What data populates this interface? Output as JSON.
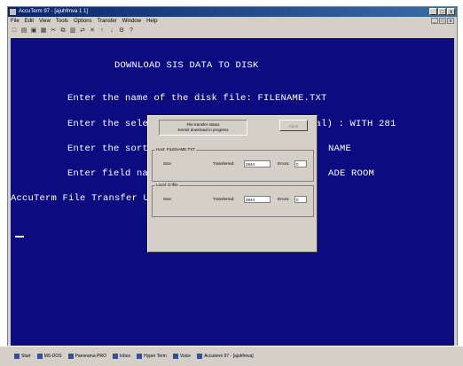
{
  "window": {
    "title": "AccuTerm 97 - [ajuhfmva 1 1]",
    "menu": [
      "File",
      "Edit",
      "View",
      "Tools",
      "Options",
      "Transfer",
      "Window",
      "Help"
    ],
    "doc_buttons": [
      "_",
      "□",
      "x"
    ],
    "controls": [
      "_",
      "□",
      "x"
    ]
  },
  "toolbar": {
    "icons": [
      "new-icon",
      "open-icon",
      "save-icon",
      "print-icon",
      "cut-icon",
      "copy-icon",
      "paste-icon",
      "connect-icon",
      "disconnect-icon",
      "upload-icon",
      "download-icon",
      "settings-icon",
      "help-icon"
    ],
    "glyphs": [
      "□",
      "▤",
      "▣",
      "▦",
      "✂",
      "⧉",
      "▥",
      "⇄",
      "✕",
      "↑",
      "↓",
      "⚙",
      "?"
    ]
  },
  "terminal": {
    "heading": "DOWNLOAD SIS DATA TO DISK",
    "line_file": "Enter the name of the disk file: FILENAME.TXT",
    "line_selection": "Enter the selection criteria (WITH...optional) : WITH 281",
    "line_sort_left": "Enter the sort or",
    "line_sort_right": "NAME",
    "line_field_left": "Enter field names",
    "line_field_right": "ADE ROOM",
    "line_accuterm": "AccuTerm File Transfer Util"
  },
  "dialog": {
    "status_line1": "File transfer status",
    "status_line2": "Kermit download in progress",
    "ok_label": "Abort",
    "group1_title": "Host: FILENAME.TXT",
    "group2_title": "Local: D:\\file",
    "size_label": "Size:",
    "transferred_label": "Transferred:",
    "transferred_value": "2844",
    "errors_label": "Errors:",
    "errors_value": "0",
    "transferred_value2": "2844",
    "errors_value2": "0"
  },
  "taskbar": {
    "items": [
      "Start",
      "MS-DOS",
      "Panorama PRO",
      "Inbox",
      "Hyper Term",
      "Voice",
      "Accuterm 97 - [ajuhfmva]"
    ]
  }
}
